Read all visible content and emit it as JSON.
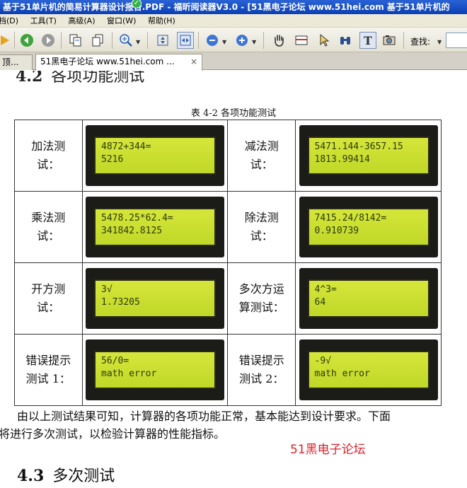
{
  "window": {
    "title": "基于51单片机的简易计算器设计报告.PDF - 福昕阅读器V3.0 - [51黑电子论坛 www.51hei.com 基于51单片机的"
  },
  "menu": {
    "items": [
      "档(D)",
      "工具(T)",
      "高级(A)",
      "窗口(W)",
      "帮助(H)"
    ]
  },
  "toolbar": {
    "find_label": "查找:"
  },
  "tabs": [
    {
      "label": "顶..."
    },
    {
      "label": "51黑电子论坛 www.51hei.com ...",
      "close": "×"
    }
  ],
  "document": {
    "section_cut_number": "4.2",
    "section_cut_title": "各项功能测试",
    "table_caption": "表 4-2  各项功能测试",
    "rows": [
      [
        {
          "label_line1": "加法测",
          "label_line2": "试：",
          "lcd_line1": "4872+344=",
          "lcd_line2": "5216"
        },
        {
          "label_line1": "减法测",
          "label_line2": "试：",
          "lcd_line1": "5471.144-3657.15",
          "lcd_line2": "1813.99414"
        }
      ],
      [
        {
          "label_line1": "乘法测",
          "label_line2": "试：",
          "lcd_line1": "5478.25*62.4=",
          "lcd_line2": "341842.8125"
        },
        {
          "label_line1": "除法测",
          "label_line2": "试：",
          "lcd_line1": "7415.24/8142=",
          "lcd_line2": "0.910739"
        }
      ],
      [
        {
          "label_line1": "开方测",
          "label_line2": "试：",
          "lcd_line1": "3√",
          "lcd_line2": "1.73205"
        },
        {
          "label_line1": "多次方运",
          "label_line2": "算测试：",
          "lcd_line1": "4^3=",
          "lcd_line2": "64"
        }
      ],
      [
        {
          "label_line1": "错误提示",
          "label_line2": "测试 1：",
          "lcd_line1": "56/0=",
          "lcd_line2": "math error"
        },
        {
          "label_line1": "错误提示",
          "label_line2": "测试 2：",
          "lcd_line1": "-9√",
          "lcd_line2": "math error"
        }
      ]
    ],
    "paragraph_line1": "由以上测试结果可知，计算器的各项功能正常，基本能达到设计要求。下面",
    "paragraph_line2": "将进行多次测试，以检验计算器的性能指标。",
    "watermark": "51黑电子论坛",
    "next_section_number": "4.3",
    "next_section_title": "多次测试"
  }
}
